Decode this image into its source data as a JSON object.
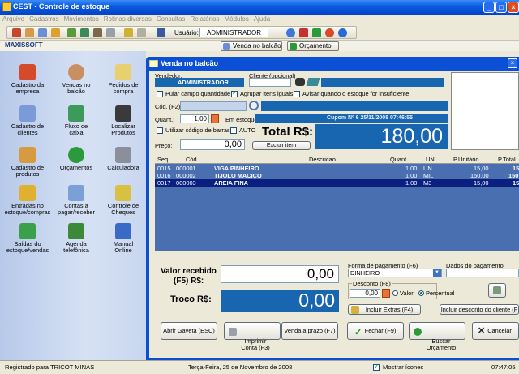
{
  "app": {
    "title": "CEST - Controle de estoque"
  },
  "menu": [
    "Arquivo",
    "Cadastros",
    "Movimentos",
    "Rotinas diversas",
    "Consultas",
    "Relatórios",
    "Módulos",
    "Ajuda"
  ],
  "toolbar": {
    "user_label": "Usuário:",
    "user_value": "ADMINISTRADOR"
  },
  "brand": "MAXISSOFT",
  "top_buttons": {
    "venda": "Venda no balcão",
    "orcamento": "Orçamento"
  },
  "sidebar": {
    "items": [
      {
        "label": "Cadastro da\nempresa",
        "icon": "house-icon"
      },
      {
        "label": "Vendas no\nbalcão",
        "icon": "person-icon"
      },
      {
        "label": "Pedidos de\ncompra",
        "icon": "pencil-notepad-icon"
      },
      {
        "label": "Cadastro de\nclientes",
        "icon": "people-icon"
      },
      {
        "label": "Fluxo de\ncaixa",
        "icon": "money-icon"
      },
      {
        "label": "Localizar\nProdutos",
        "icon": "binoculars-icon"
      },
      {
        "label": "Cadastro de\nprodutos",
        "icon": "boxes-icon"
      },
      {
        "label": "Orçamentos",
        "icon": "dollar-icon"
      },
      {
        "label": "Calculadora",
        "icon": "calculator-icon"
      },
      {
        "label": "Entradas no\nestoque/compras",
        "icon": "arrow-down-icon"
      },
      {
        "label": "Contas a\npagar/receber",
        "icon": "coins-icon"
      },
      {
        "label": "Controle de\nCheques",
        "icon": "pen-check-icon"
      },
      {
        "label": "Saídas do\nestoque/vendas",
        "icon": "arrow-up-icon"
      },
      {
        "label": "Agenda\ntelefônica",
        "icon": "agenda-icon"
      },
      {
        "label": "Manual\nOnline",
        "icon": "manual-icon"
      }
    ]
  },
  "window": {
    "title": "Venda no balcão",
    "vendedor_label": "Vendedor:",
    "vendedor_value": "ADMINISTRADOR",
    "cliente_label": "Cliente (opcional)",
    "opt_pular": "Pular campo quantidade",
    "opt_agrupar": "Agrupar itens iguais",
    "opt_avisar": "Avisar quando o estoque for insuficiente",
    "cod_label": "Cód. (F2):",
    "quant_label": "Quant.:",
    "quant_value": "1,00",
    "em_estoque_label": "Em estoque:",
    "cupom": "Cupom Nº  6   25/11/2008  07:46:55",
    "opt_barras": "Utilizar código de barras",
    "opt_auto": "AUTO",
    "total_label": "Total R$:",
    "total_value": "180,00",
    "preco_label": "Preço:",
    "preco_value": "0,00",
    "excluir_label": "Excluir item",
    "grid_headers": [
      "Seq",
      "Cód",
      "Descricao",
      "Quant",
      "UN",
      "P.Unitário",
      "P.Total"
    ],
    "grid_rows": [
      {
        "seq": "0015",
        "cod": "000001",
        "desc": "VIGA PINHEIRO",
        "quant": "1,00",
        "un": "UN",
        "punit": "15,00",
        "ptotal": "15"
      },
      {
        "seq": "0016",
        "cod": "000002",
        "desc": "TIJOLO MACIÇO",
        "quant": "1,00",
        "un": "MIL",
        "punit": "150,00",
        "ptotal": "150"
      },
      {
        "seq": "0017",
        "cod": "000003",
        "desc": "AREIA FINA",
        "quant": "1,00",
        "un": "M3",
        "punit": "15,00",
        "ptotal": "15"
      }
    ],
    "valor_recebido_label1": "Valor recebido",
    "valor_recebido_label2": "(F5)  R$:",
    "valor_recebido_value": "0,00",
    "troco_label": "Troco R$:",
    "troco_value": "0,00",
    "forma_label": "Forma de pagamento (F6)",
    "forma_value": "DINHEIRO",
    "dados_label": "Dados do pagamento",
    "desconto_label": "Desconto (F8)",
    "desconto_value": "0,00",
    "radio_valor": "Valor",
    "radio_percentual": "Percentual",
    "incluir_extras": "Incluir Extras (F4)",
    "incluir_desconto": "Incluir desconto do cliente (F",
    "btn_gaveta": "Abrir Gaveta (ESC)",
    "btn_imprimir": "Imprimir\nConta (F3)",
    "btn_prazo": "Venda a prazo (F7)",
    "btn_fechar": "Fechar (F9)",
    "btn_buscar": "Buscar\nOrçamento",
    "btn_cancelar": "Cancelar"
  },
  "status": {
    "registered": "Registrado para TRICOT MINAS",
    "date": "Terça-Feira, 25 de Novembro de 2008",
    "mostrar": "Mostrar ícones",
    "time": "07:47:05"
  }
}
